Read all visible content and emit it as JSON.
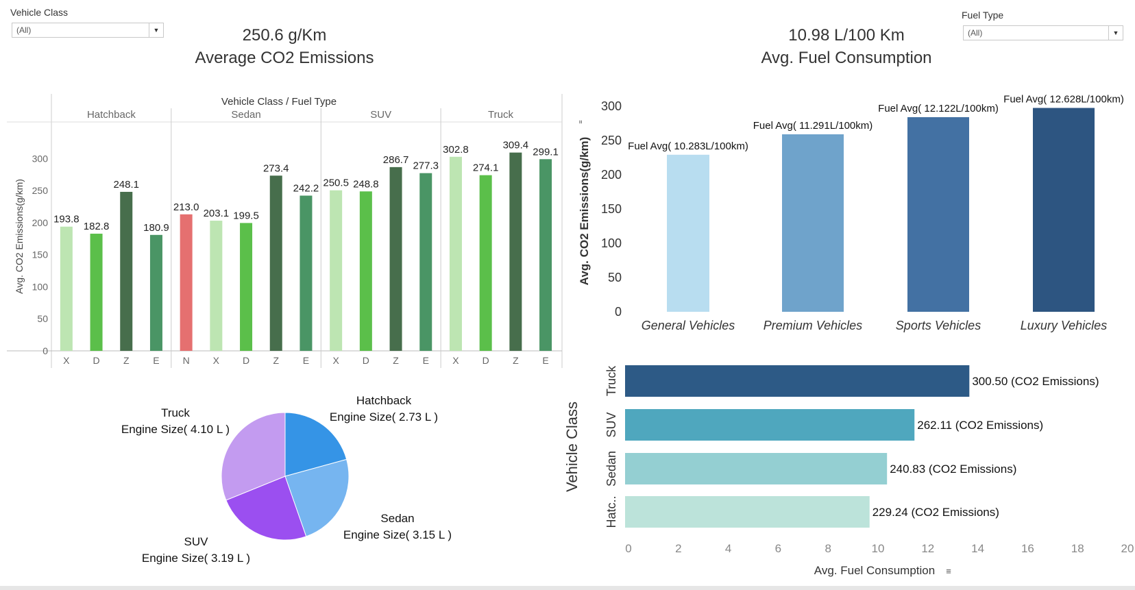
{
  "filters": {
    "vehicle_class": {
      "label": "Vehicle Class",
      "value": "(All)"
    },
    "fuel_type": {
      "label": "Fuel Type",
      "value": "(All)"
    }
  },
  "kpis": {
    "co2": {
      "value": "250.6 g/Km",
      "label": "Average CO2 Emissions"
    },
    "fuel": {
      "value": "10.98 L/100 Km",
      "label": "Avg. Fuel Consumption"
    }
  },
  "chart_data": [
    {
      "type": "bar",
      "title": "Vehicle Class  /  Fuel Type",
      "ylabel": "Avg. CO2 Emissions(g/km)",
      "ylim": [
        0,
        330
      ],
      "yticks": [
        0,
        50,
        100,
        150,
        200,
        250,
        300
      ],
      "groups": [
        {
          "name": "Hatchback",
          "bars": [
            {
              "category": "X",
              "value": 193.8
            },
            {
              "category": "D",
              "value": 182.8
            },
            {
              "category": "Z",
              "value": 248.1
            },
            {
              "category": "E",
              "value": 180.9
            }
          ]
        },
        {
          "name": "Sedan",
          "bars": [
            {
              "category": "N",
              "value": 213.0
            },
            {
              "category": "X",
              "value": 203.1
            },
            {
              "category": "D",
              "value": 199.5
            },
            {
              "category": "Z",
              "value": 273.4
            },
            {
              "category": "E",
              "value": 242.2
            }
          ]
        },
        {
          "name": "SUV",
          "bars": [
            {
              "category": "X",
              "value": 250.5
            },
            {
              "category": "D",
              "value": 248.8
            },
            {
              "category": "Z",
              "value": 286.7
            },
            {
              "category": "E",
              "value": 277.3
            }
          ]
        },
        {
          "name": "Truck",
          "bars": [
            {
              "category": "X",
              "value": 302.8
            },
            {
              "category": "D",
              "value": 274.1
            },
            {
              "category": "Z",
              "value": 309.4
            },
            {
              "category": "E",
              "value": 299.1
            }
          ]
        }
      ],
      "colors": {
        "X": "#bde5b2",
        "D": "#5bbf4a",
        "Z": "#476e4c",
        "E": "#4a9565",
        "N": "#e57070"
      }
    },
    {
      "type": "bar",
      "ylabel": "Avg. CO2 Emissions(g/km)",
      "ylim": [
        0,
        310
      ],
      "yticks": [
        0,
        50,
        100,
        150,
        200,
        250,
        300
      ],
      "categories": [
        "General Vehicles",
        "Premium Vehicles",
        "Sports Vehicles",
        "Luxury Vehicles"
      ],
      "values": [
        229.2,
        259.0,
        284.0,
        297.5
      ],
      "labels": [
        "Fuel Avg( 10.283L/100km)",
        "Fuel Avg( 11.291L/100km)",
        "Fuel Avg( 12.122L/100km)",
        "Fuel Avg( 12.628L/100km)"
      ],
      "colors": [
        "#b8ddf0",
        "#6fa3cb",
        "#4371a3",
        "#2d5581"
      ]
    },
    {
      "type": "pie",
      "slices": [
        {
          "name": "Hatchback",
          "label": "Engine Size( 2.73 L )",
          "value": 2.73,
          "color": "#3594e6"
        },
        {
          "name": "Sedan",
          "label": "Engine Size( 3.15 L )",
          "value": 3.15,
          "color": "#76b5f0"
        },
        {
          "name": "SUV",
          "label": "Engine Size( 3.19 L )",
          "value": 3.19,
          "color": "#9b4ff0"
        },
        {
          "name": "Truck",
          "label": "Engine Size( 4.10 L )",
          "value": 4.1,
          "color": "#c39bf0"
        }
      ]
    },
    {
      "type": "bar",
      "orientation": "horizontal",
      "ylabel": "Vehicle Class",
      "xlabel": "Avg. Fuel Consumption",
      "xlim": [
        0,
        20
      ],
      "xticks": [
        0,
        2,
        4,
        6,
        8,
        10,
        12,
        14,
        16,
        18,
        20
      ],
      "categories": [
        "Truck",
        "SUV",
        "Sedan",
        "Hatc.."
      ],
      "values": [
        13.8,
        11.6,
        10.5,
        9.8
      ],
      "labels": [
        "300.50  (CO2 Emissions)",
        "262.11  (CO2 Emissions)",
        "240.83  (CO2 Emissions)",
        "229.24  (CO2 Emissions)"
      ],
      "colors": [
        "#2d5a86",
        "#4fa7be",
        "#94cfd2",
        "#bce3da"
      ]
    }
  ]
}
